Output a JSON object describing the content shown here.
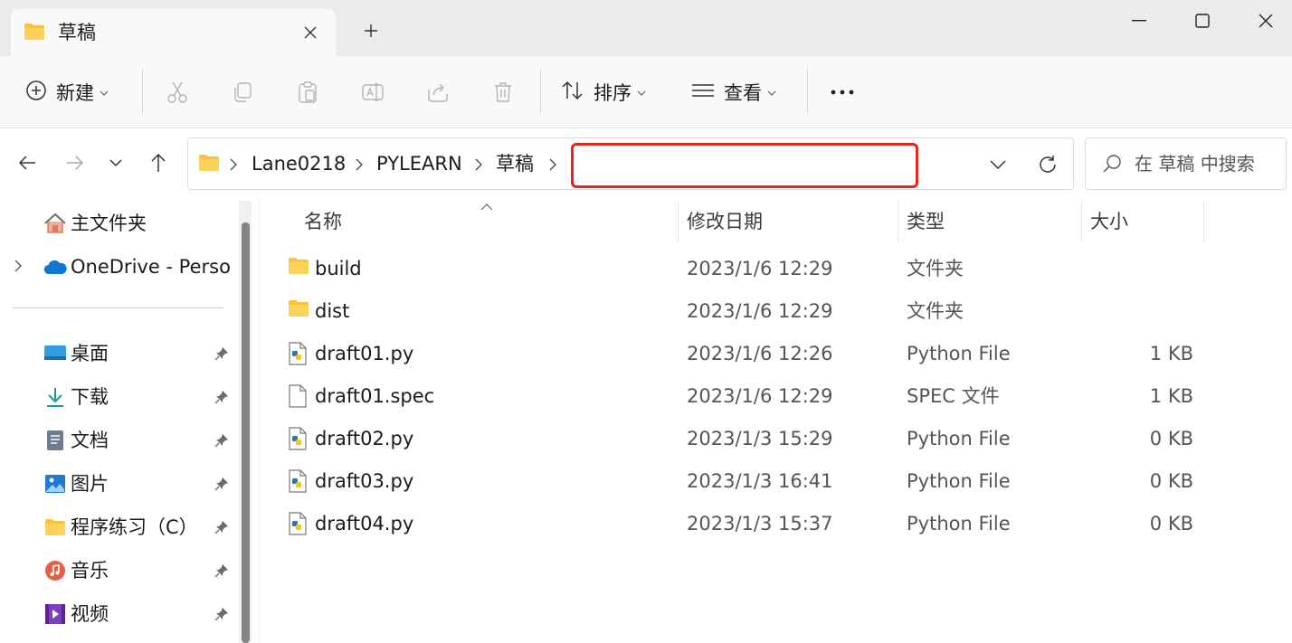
{
  "window": {
    "tab_title": "草稿",
    "close_tab_glyph": "✕",
    "new_tab_glyph": "+"
  },
  "toolbar": {
    "new_label": "新建",
    "sort_label": "排序",
    "view_label": "查看",
    "more_glyph": "•••",
    "icons": [
      "cut-icon",
      "copy-icon",
      "paste-icon",
      "rename-icon",
      "share-icon",
      "delete-icon"
    ]
  },
  "address": {
    "breadcrumbs": [
      "Lane0218",
      "PYLEARN",
      "草稿"
    ],
    "input_value": "",
    "search_placeholder": "在 草稿 中搜索"
  },
  "sidebar": {
    "items": [
      {
        "label": "主文件夹",
        "icon": "home-icon",
        "pinned": false
      },
      {
        "label": "OneDrive - Perso",
        "icon": "onedrive-icon",
        "pinned": false
      },
      {
        "label": "桌面",
        "icon": "desktop-icon",
        "pinned": true
      },
      {
        "label": "下载",
        "icon": "download-icon",
        "pinned": true
      },
      {
        "label": "文档",
        "icon": "documents-icon",
        "pinned": true
      },
      {
        "label": "图片",
        "icon": "pictures-icon",
        "pinned": true
      },
      {
        "label": "程序练习（C）",
        "icon": "folder-icon",
        "pinned": true
      },
      {
        "label": "音乐",
        "icon": "music-icon",
        "pinned": true
      },
      {
        "label": "视频",
        "icon": "videos-icon",
        "pinned": true
      }
    ]
  },
  "list": {
    "headers": {
      "name": "名称",
      "date": "修改日期",
      "type": "类型",
      "size": "大小"
    },
    "rows": [
      {
        "name": "build",
        "date": "2023/1/6 12:29",
        "type": "文件夹",
        "size": "",
        "icon": "folder-icon"
      },
      {
        "name": "dist",
        "date": "2023/1/6 12:29",
        "type": "文件夹",
        "size": "",
        "icon": "folder-icon"
      },
      {
        "name": "draft01.py",
        "date": "2023/1/6 12:26",
        "type": "Python File",
        "size": "1 KB",
        "icon": "python-file-icon"
      },
      {
        "name": "draft01.spec",
        "date": "2023/1/6 12:29",
        "type": "SPEC 文件",
        "size": "1 KB",
        "icon": "file-icon"
      },
      {
        "name": "draft02.py",
        "date": "2023/1/3 15:29",
        "type": "Python File",
        "size": "0 KB",
        "icon": "python-file-icon"
      },
      {
        "name": "draft03.py",
        "date": "2023/1/3 16:41",
        "type": "Python File",
        "size": "0 KB",
        "icon": "python-file-icon"
      },
      {
        "name": "draft04.py",
        "date": "2023/1/3 15:37",
        "type": "Python File",
        "size": "0 KB",
        "icon": "python-file-icon"
      }
    ]
  },
  "colors": {
    "highlight_border": "#e8231d",
    "folder": "#f8c33b",
    "accent": "#0063b1"
  }
}
